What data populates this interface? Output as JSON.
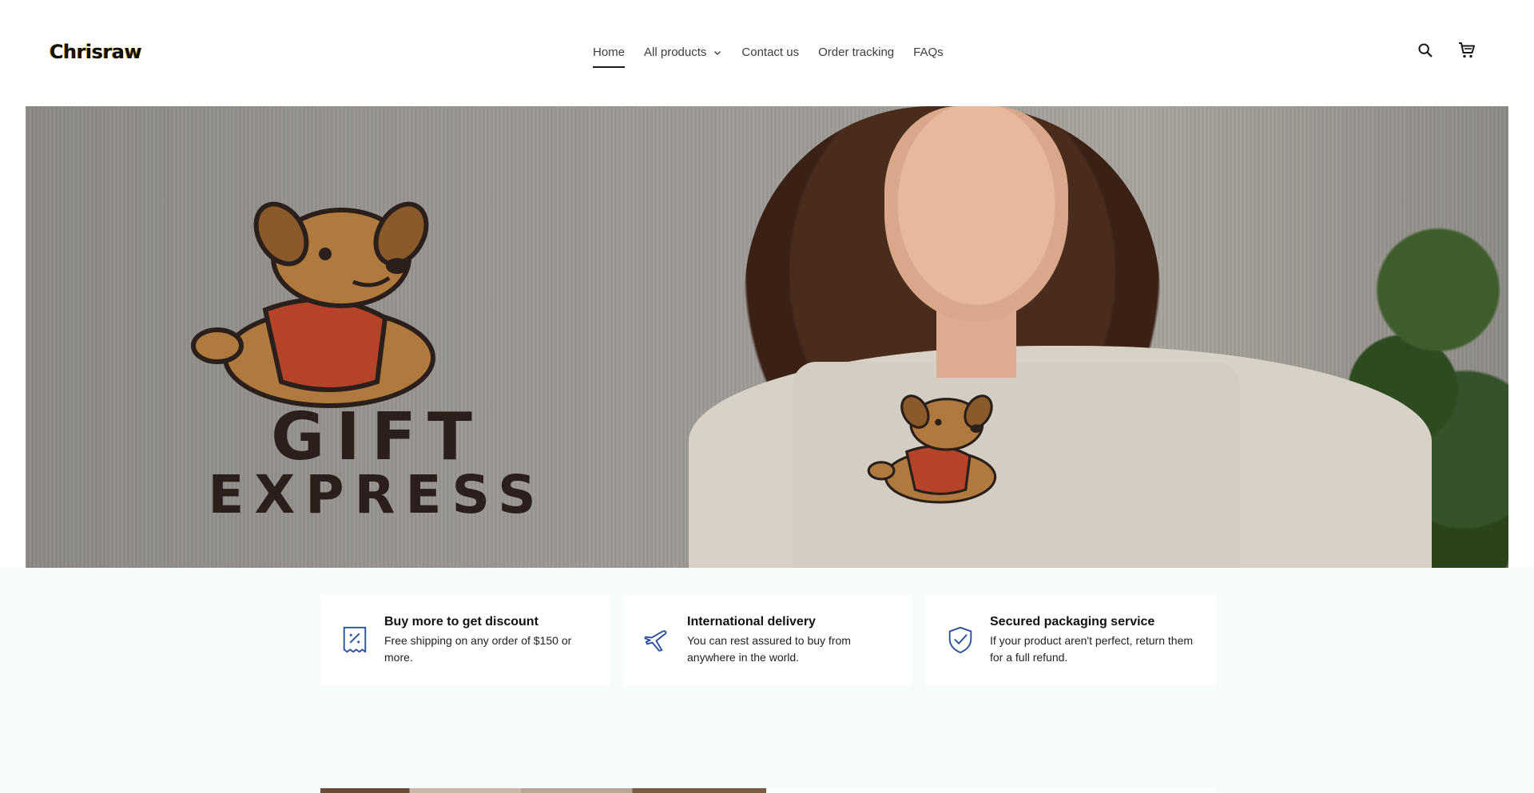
{
  "header": {
    "logo_text": "Chrisraw",
    "nav": [
      {
        "label": "Home"
      },
      {
        "label": "All products"
      },
      {
        "label": "Contact us"
      },
      {
        "label": "Order tracking"
      },
      {
        "label": "FAQs"
      }
    ]
  },
  "hero": {
    "graphic_line1": "GIFT",
    "graphic_line2": "EXPRESS"
  },
  "features": [
    {
      "icon": "discount-tag-icon",
      "title": "Buy more to get discount",
      "text": "Free shipping on any order of $150 or more."
    },
    {
      "icon": "airplane-icon",
      "title": "International delivery",
      "text": "You can rest assured to buy from anywhere in the world."
    },
    {
      "icon": "shield-check-icon",
      "title": "Secured packaging service",
      "text": "If your product aren't perfect, return them for a full refund."
    }
  ],
  "colors": {
    "accent_icon": "#2c4f9e",
    "features_bg": "#f6fbfb",
    "logo_accent": "#e8951c"
  }
}
